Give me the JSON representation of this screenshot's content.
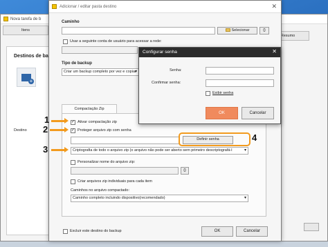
{
  "main_window": {
    "title": "Nova tarefa de b",
    "tabs": [
      "Itens",
      "Resumo"
    ],
    "destinations_label": "Destinos de backup",
    "destination_column": "Destino"
  },
  "dialog": {
    "title": "Adicionar / editar pasta destino",
    "path": {
      "label": "Caminho",
      "value": "",
      "select_button": "Selecionar",
      "braces_button": "{}"
    },
    "network_account": {
      "checked": false,
      "label": "Usar a seguinte conta de usuário para acessar a rede:"
    },
    "backup_type": {
      "label": "Tipo de backup",
      "value": "Criar um backup completo por vez e copiar"
    },
    "subtab": "Compactação Zip",
    "enable_zip": {
      "checked": true,
      "label": "Ativar compactação zip"
    },
    "protect_zip": {
      "checked": true,
      "label": "Proteger arquivo zip com senha"
    },
    "define_password_button": "Definir senha",
    "encryption": {
      "value": "Criptografia de todo o arquivo zip (o arquivo não pode ser aberto sem primeiro descriptografá-l"
    },
    "custom_name": {
      "checked": false,
      "label": "Personalizar nome do arquivo zip:",
      "value": "",
      "braces_button": "{}"
    },
    "individual_zip": {
      "checked": false,
      "label": "Criar arquivos zip individuais para cada item"
    },
    "paths_label": "Caminhos no arquivo compactado:",
    "paths_value": "Caminho completo incluindo dispositivo(recomendado)",
    "exclude_destination": {
      "checked": false,
      "label": "Excluir este destino do backup"
    },
    "ok_button": "OK",
    "cancel_button": "Cancelar"
  },
  "password_dialog": {
    "title": "Configurar senha",
    "password_label": "Senha:",
    "password_value": "",
    "confirm_label": "Confirmar senha:",
    "confirm_value": "",
    "show_password": {
      "checked": false,
      "label": "Exibir senha"
    },
    "ok_button": "OK",
    "cancel_button": "Cancelar"
  },
  "annotations": [
    "1",
    "2",
    "3",
    "4"
  ],
  "colors": {
    "annotation_orange": "#f29a1d",
    "ok_orange": "#f08a5d",
    "title_dark": "#2b2b2b"
  }
}
